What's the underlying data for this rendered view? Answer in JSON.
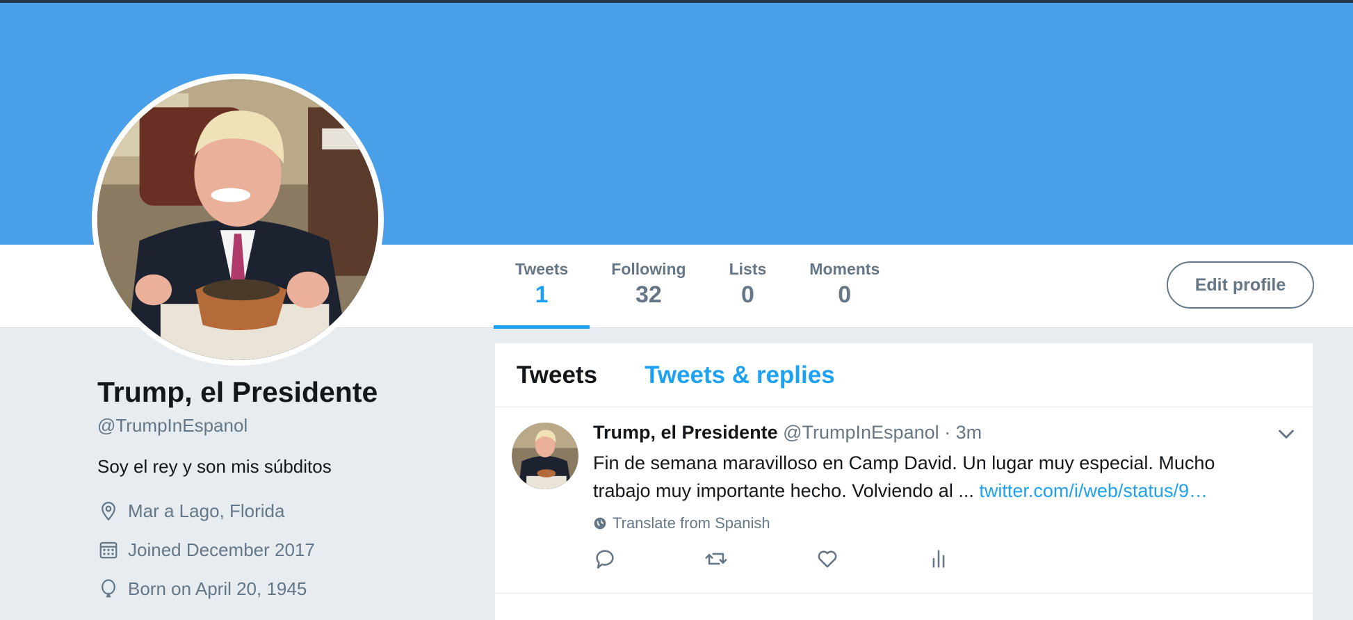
{
  "profile": {
    "name": "Trump, el Presidente",
    "handle": "@TrumpInEspanol",
    "bio": "Soy el rey y son mis súbditos",
    "location": "Mar a Lago, Florida",
    "joined": "Joined December 2017",
    "born": "Born on April 20, 1945"
  },
  "stats": [
    {
      "label": "Tweets",
      "value": "1"
    },
    {
      "label": "Following",
      "value": "32"
    },
    {
      "label": "Lists",
      "value": "0"
    },
    {
      "label": "Moments",
      "value": "0"
    }
  ],
  "edit_profile_label": "Edit profile",
  "timeline": {
    "tabs": [
      "Tweets",
      "Tweets & replies"
    ]
  },
  "tweet": {
    "name": "Trump, el Presidente",
    "handle": "@TrumpInEspanol",
    "time": "· 3m",
    "text": "Fin de semana maravilloso en Camp David. Un lugar muy especial. Mucho trabajo muy importante hecho. Volviendo al ...",
    "link": "twitter.com/i/web/status/9…",
    "translate_label": "Translate from Spanish"
  },
  "icons": {
    "location": "location-pin-icon",
    "joined": "calendar-icon",
    "born": "balloon-icon",
    "translate": "globe-icon",
    "reply": "reply-icon",
    "retweet": "retweet-icon",
    "like": "heart-icon",
    "analytics": "analytics-icon",
    "caret": "chevron-down-icon"
  },
  "colors": {
    "banner": "#4a9fe9",
    "accent": "#1da1f2",
    "muted": "#657786",
    "background": "#e6ecf0"
  }
}
